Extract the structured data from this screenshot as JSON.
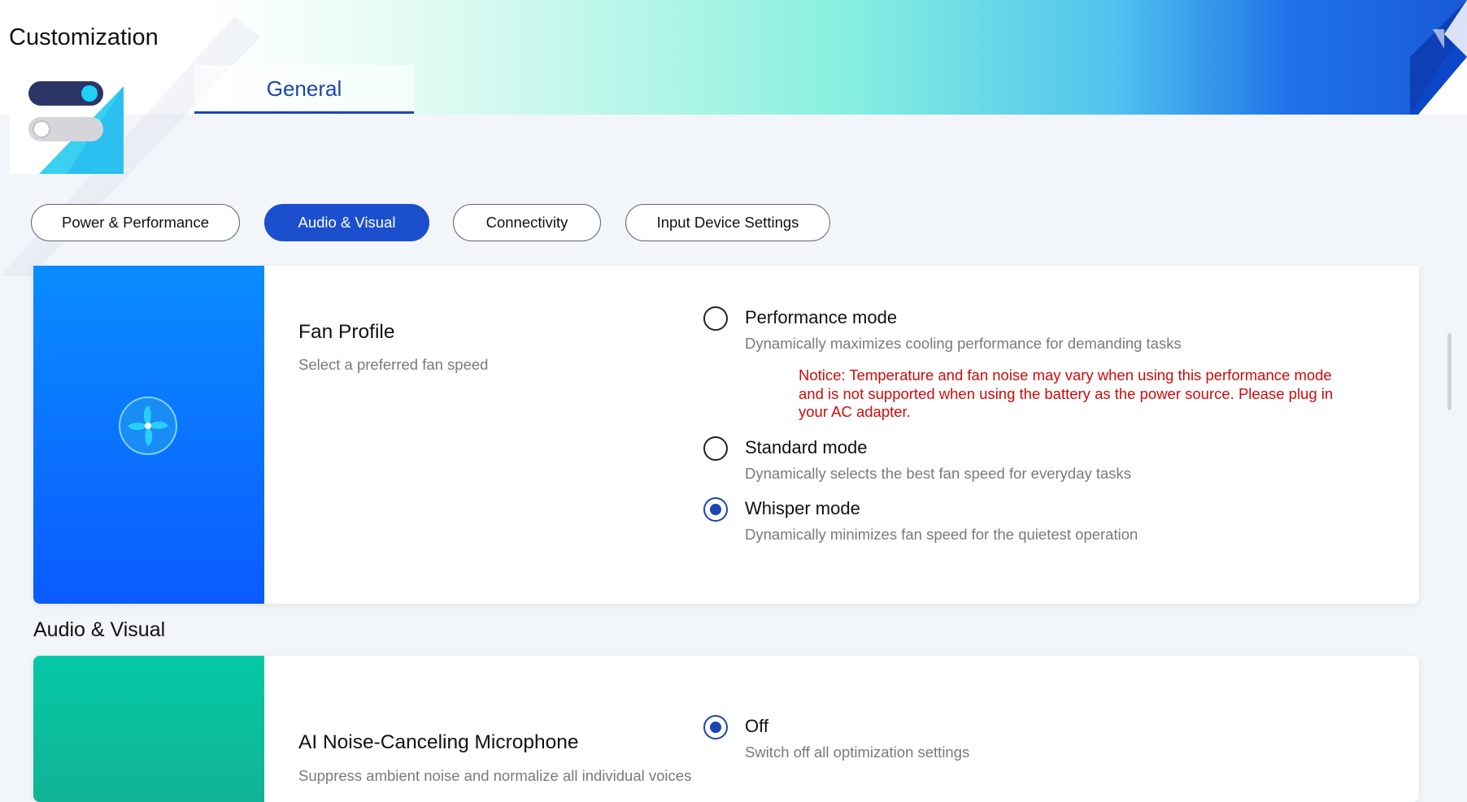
{
  "window": {
    "title": "Customization"
  },
  "tabs": [
    {
      "label": "General",
      "selected": true
    }
  ],
  "filters": [
    {
      "label": "Power & Performance",
      "active": false
    },
    {
      "label": "Audio & Visual",
      "active": true
    },
    {
      "label": "Connectivity",
      "active": false
    },
    {
      "label": "Input Device Settings",
      "active": false
    }
  ],
  "fan_profile": {
    "icon": "fan-icon",
    "title": "Fan Profile",
    "subtitle": "Select a preferred fan speed",
    "options": [
      {
        "label": "Performance mode",
        "description": "Dynamically maximizes cooling performance for demanding tasks",
        "selected": false
      },
      {
        "label": "Standard mode",
        "description": "Dynamically selects the best fan speed for everyday tasks",
        "selected": false
      },
      {
        "label": "Whisper mode",
        "description": "Dynamically minimizes fan speed for the quietest operation",
        "selected": true
      }
    ],
    "notice": "Notice: Temperature and fan noise may vary when using this performance mode and is not supported when using the battery as the power source. Please plug in your AC adapter."
  },
  "section_audio_visual": {
    "heading": "Audio & Visual"
  },
  "ai_noise_mic": {
    "title": "AI Noise-Canceling Microphone",
    "subtitle": "Suppress ambient noise and normalize all individual voices",
    "options": [
      {
        "label": "Off",
        "description": "Switch off all optimization settings",
        "selected": true
      }
    ]
  },
  "colors": {
    "accent": "#1b4fce",
    "tab_underline": "#1b45b0",
    "notice_red": "#d20a0a",
    "fan_card_side": "#0a6cff",
    "mic_card_side": "#05c8a6"
  }
}
